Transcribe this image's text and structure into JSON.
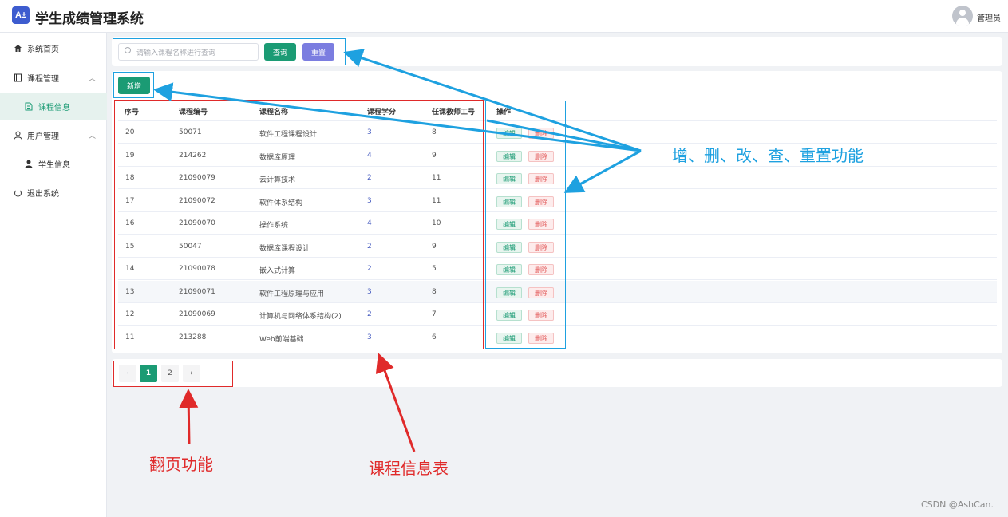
{
  "header": {
    "logo_text": "A±",
    "title": "学生成绩管理系统",
    "user": "管理员"
  },
  "sidebar": {
    "items": [
      {
        "label": "系统首页",
        "icon": "home-icon"
      },
      {
        "label": "课程管理",
        "icon": "book-icon"
      },
      {
        "label": "课程信息",
        "icon": "document-icon"
      },
      {
        "label": "用户管理",
        "icon": "user-icon"
      },
      {
        "label": "学生信息",
        "icon": "person-icon"
      },
      {
        "label": "退出系统",
        "icon": "power-icon"
      }
    ]
  },
  "search": {
    "placeholder": "请输入课程名称进行查询",
    "query_label": "查询",
    "reset_label": "重置"
  },
  "toolbar": {
    "add_label": "新增"
  },
  "table": {
    "headers": [
      "序号",
      "课程编号",
      "课程名称",
      "课程学分",
      "任课教师工号",
      "操作"
    ],
    "rows": [
      [
        "20",
        "50071",
        "软件工程课程设计",
        "3",
        "8"
      ],
      [
        "19",
        "214262",
        "数据库原理",
        "4",
        "9"
      ],
      [
        "18",
        "21090079",
        "云计算技术",
        "2",
        "11"
      ],
      [
        "17",
        "21090072",
        "软件体系结构",
        "3",
        "11"
      ],
      [
        "16",
        "21090070",
        "操作系统",
        "4",
        "10"
      ],
      [
        "15",
        "50047",
        "数据库课程设计",
        "2",
        "9"
      ],
      [
        "14",
        "21090078",
        "嵌入式计算",
        "2",
        "5"
      ],
      [
        "13",
        "21090071",
        "软件工程原理与应用",
        "3",
        "8"
      ],
      [
        "12",
        "21090069",
        "计算机与网络体系结构(2)",
        "2",
        "7"
      ],
      [
        "11",
        "213288",
        "Web前端基础",
        "3",
        "6"
      ]
    ],
    "edit_label": "编辑",
    "delete_label": "删除"
  },
  "pagination": {
    "prev": "‹",
    "pages": [
      "1",
      "2"
    ],
    "next": "›",
    "current": "1"
  },
  "annotations": {
    "crud": "增、删、改、查、重置功能",
    "paging": "翻页功能",
    "table": "课程信息表"
  },
  "watermark": "CSDN @AshCan.",
  "colors": {
    "primary": "#1b9b74",
    "reset": "#7b7de0",
    "annotation_blue": "#1ea1e0",
    "annotation_red": "#e02a2a"
  }
}
